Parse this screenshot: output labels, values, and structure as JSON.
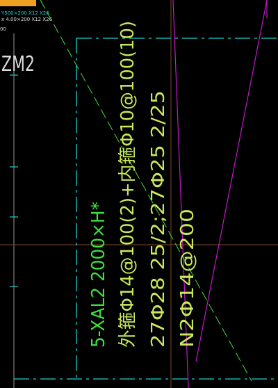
{
  "canvas": {
    "background": "#000000",
    "top_left_tag_color": "#f0a020"
  },
  "top_left_labels": {
    "line1": "Y500×200 X12 X26",
    "line2": "x 4.00×200 X12 X26",
    "line3": "00"
  },
  "zone_label": "ZM2",
  "beam_annotation": {
    "line1": "5-XAL2  2000×H*",
    "line2": "外箍Φ14@100(2)+内箍Φ10@100(10)",
    "line3": "27Φ28 25/2;27Φ25 2/25",
    "line4": "N2Φ14@200"
  },
  "colors": {
    "cyan": "#19d3cf",
    "green": "#3ee13e",
    "yellow_green": "#c9e85a",
    "magenta": "#c41acb",
    "grid_brown": "#7b4a2a",
    "white_line": "#dcdcdc"
  }
}
